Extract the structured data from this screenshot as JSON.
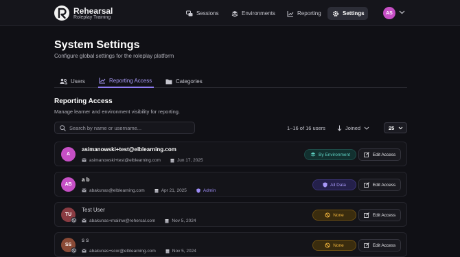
{
  "brand": {
    "name": "Rehearsal",
    "subtitle": "Roleplay Training"
  },
  "nav": {
    "items": [
      {
        "label": "Sessions",
        "icon": "chat-bubbles-icon",
        "active": false
      },
      {
        "label": "Environments",
        "icon": "layers-icon",
        "active": false
      },
      {
        "label": "Reporting",
        "icon": "line-chart-icon",
        "active": false
      },
      {
        "label": "Settings",
        "icon": "gear-icon",
        "active": true
      }
    ],
    "user_initials": "AS"
  },
  "page": {
    "title": "System Settings",
    "subtitle": "Configure global settings for the roleplay platform"
  },
  "tabs": [
    {
      "label": "Users",
      "icon": "users-icon",
      "active": false
    },
    {
      "label": "Reporting Access",
      "icon": "chart-icon",
      "active": true
    },
    {
      "label": "Categories",
      "icon": "folder-icon",
      "active": false
    }
  ],
  "section": {
    "title": "Reporting Access",
    "subtitle": "Manage learner and environment visibility for reporting."
  },
  "search": {
    "placeholder": "Search by name or username...",
    "value": ""
  },
  "pagination": {
    "summary": "1–16 of 16 users"
  },
  "sort": {
    "label": "Joined"
  },
  "page_size": {
    "value": "25"
  },
  "colors": {
    "accent": "#8f7cf4",
    "teal": "#5fd3c4",
    "amber": "#f0b43c"
  },
  "users": [
    {
      "initials": "A",
      "avatar_color": "#c64fc5",
      "name": "asimanowski+test@elblearning.com",
      "email": "asimanowski+test@elblearning.com",
      "date": "Jun 17, 2025",
      "role": "",
      "access": "By Environment",
      "access_kind": "env",
      "disabled": false,
      "action": "Edit Access"
    },
    {
      "initials": "AB",
      "avatar_color": "#c64fc5",
      "name": "a b",
      "email": "abakunas@elblearning.com",
      "date": "Apr 21, 2025",
      "role": "Admin",
      "access": "All Data",
      "access_kind": "all",
      "disabled": false,
      "action": "Edit Access"
    },
    {
      "initials": "TU",
      "avatar_color": "#8a3b42",
      "name": "Test User",
      "email": "abakunas+mailnw@rehersal.com",
      "date": "Nov 5, 2024",
      "role": "",
      "access": "None",
      "access_kind": "none",
      "disabled": true,
      "action": "Edit Access"
    },
    {
      "initials": "SS",
      "avatar_color": "#8a4a36",
      "name": "s s",
      "email": "abakunas+scor@elblearning.com",
      "date": "Nov 5, 2024",
      "role": "",
      "access": "None",
      "access_kind": "none",
      "disabled": true,
      "action": "Edit Access"
    }
  ]
}
